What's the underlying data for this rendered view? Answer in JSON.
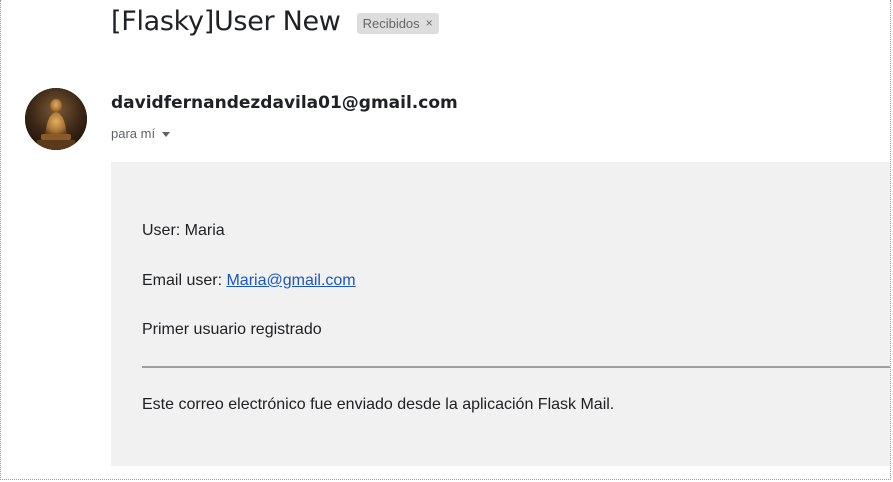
{
  "email": {
    "subject": "[Flasky]User New",
    "label": "Recibidos",
    "label_close": "×",
    "sender": "davidfernandezdavila01@gmail.com",
    "recipient": "para mí",
    "body": {
      "user_line": "User: Maria",
      "email_prefix": "Email user: ",
      "email_link": "Maria@gmail.com",
      "message": "Primer usuario registrado",
      "footer": "Este correo electrónico fue enviado desde la aplicación Flask Mail."
    }
  },
  "colors": {
    "link": "#1a56c8",
    "chip_background": "#dddddd",
    "body_background": "#f1f1f1"
  },
  "icons": {
    "label_close": "close-icon",
    "recipient_details": "chevron-down-icon",
    "sender_avatar": "avatar"
  }
}
